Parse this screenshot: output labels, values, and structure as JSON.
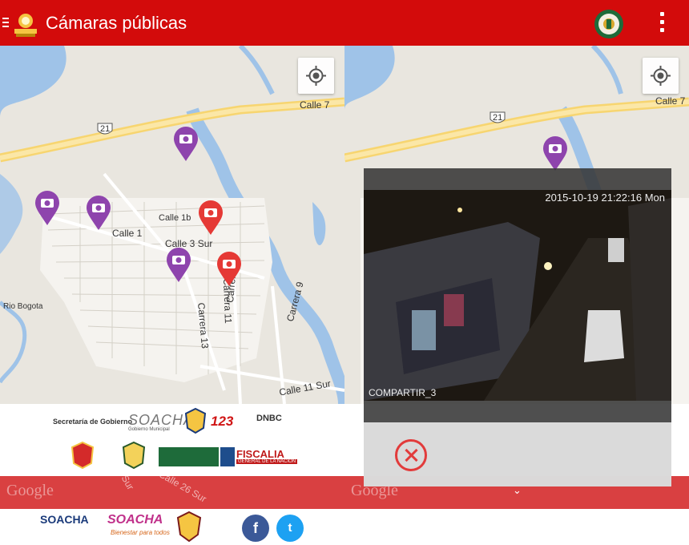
{
  "app": {
    "title": "Cámaras públicas",
    "brand_color": "#d30b0b"
  },
  "map": {
    "road_labels": {
      "calle7": "Calle 7",
      "route21": "21",
      "calle1": "Calle 1",
      "calle1b": "Calle 1b",
      "calle3sur": "Calle 3 Sur",
      "carrera11": "Carrera 11",
      "carrera12": "Carrera 12",
      "carrera13": "Carrera 13",
      "carrera9": "Carrera 9",
      "calle11sur": "Calle 11 Sur",
      "rio": "Rio Bogota",
      "calle26sur": "Calle 26 Sur",
      "sur": "Sur"
    },
    "watermark": "Google",
    "pin_colors": {
      "active": "#8e44ad",
      "offline": "#e53935"
    }
  },
  "dialog": {
    "timestamp": "2015-10-19 21:22:16 Mon",
    "camera_name": "COMPARTIR_3",
    "close_icon": "close-icon"
  },
  "sponsors": {
    "gobierno": "Secretaría de Gobierno",
    "soacha": "SOACHA",
    "soacha_sub": "Gobierno Municipal",
    "emergencia": "123",
    "dnbc": "DNBC",
    "fiscalia": "FISCALIA",
    "fiscalia_sub": "GENERAL DE LA NACIÓN",
    "alcaldia": "SOACHA",
    "bienestar": "SOACHA",
    "bienestar_sub": "Bienestar para todos"
  },
  "social": {
    "facebook": "f",
    "twitter": "t"
  }
}
